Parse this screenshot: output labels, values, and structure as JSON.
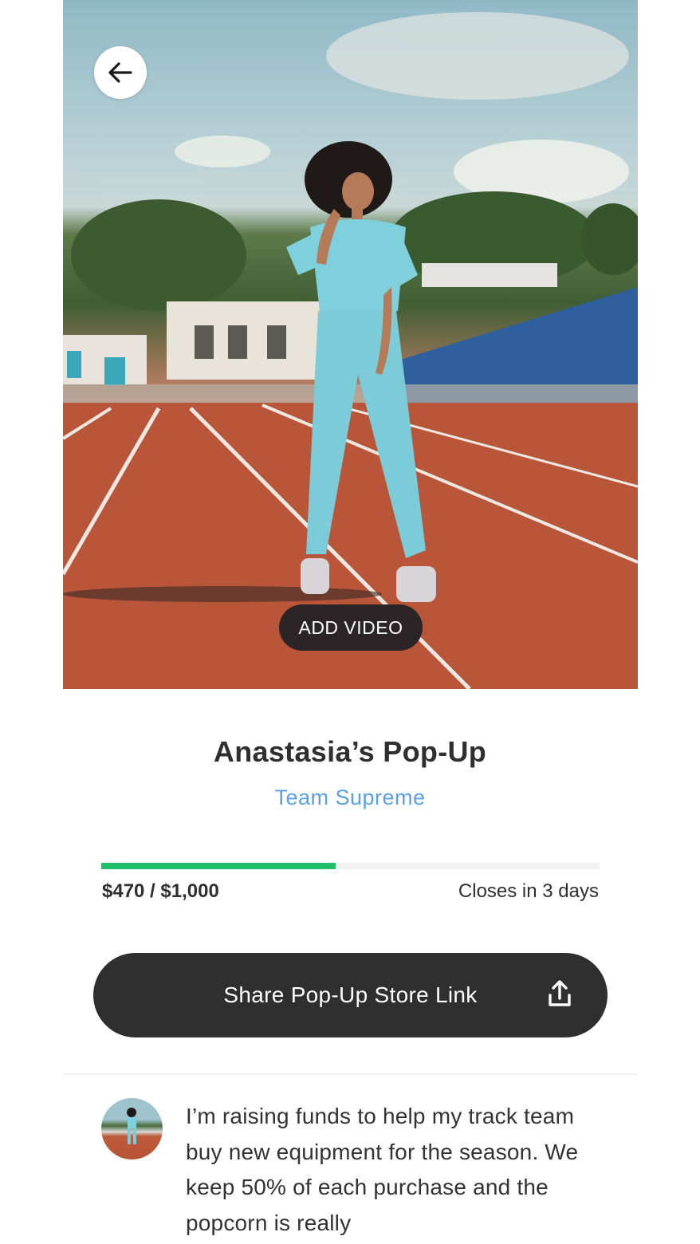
{
  "hero": {
    "back_icon": "arrow-left-icon",
    "add_video_label": "ADD VIDEO"
  },
  "store": {
    "title": "Anastasia’s Pop-Up",
    "team": "Team Supreme"
  },
  "fundraising": {
    "progress_fraction": 0.47,
    "amount_text": "$470 / $1,000",
    "closes_text": "Closes in 3 days",
    "progress_color": "#1fc06b"
  },
  "share": {
    "label": "Share Pop-Up Store Link",
    "icon": "share-upload-icon"
  },
  "about": {
    "avatar": "avatar-photo",
    "text": "I’m raising funds to help my track team buy new equipment for the season. We keep 50% of each purchase and the popcorn is really"
  },
  "colors": {
    "accent_link": "#5aa0e6",
    "button_dark": "#2f2f2f"
  }
}
